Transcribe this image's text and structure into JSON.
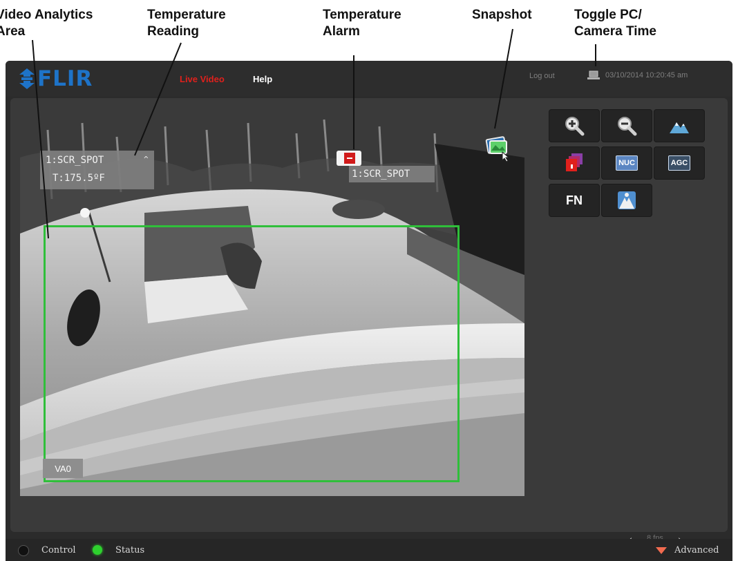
{
  "callouts": {
    "video_analytics": "Video Analytics\nArea",
    "temp_reading": "Temperature\nReading",
    "temp_alarm": "Temperature\nAlarm",
    "snapshot": "Snapshot",
    "toggle_time": "Toggle PC/\nCamera Time"
  },
  "header": {
    "logo_text": "FLIR",
    "nav_live": "Live Video",
    "nav_help": "Help",
    "logout": "Log out",
    "datetime": "03/10/2014 10:20:45 am"
  },
  "video": {
    "spot_reading_name": "1:SCR_SPOT",
    "spot_reading_caret": "^",
    "spot_temperature": "T:175.5ºF",
    "alarm_label": "1:SCR_SPOT",
    "va_label": "VA0"
  },
  "controls": {
    "fn_label": "FN",
    "nuc_label": "NUC",
    "agc_label": "AGC"
  },
  "fps": {
    "text": "8 fps"
  },
  "bottom": {
    "control_label": "Control",
    "status_label": "Status",
    "advanced_label": "Advanced"
  },
  "colors": {
    "nav_active": "#e0201c",
    "brand": "#1e73c8",
    "va_box": "#2fbf3a",
    "status_led": "#2ed12e",
    "advanced_arrow": "#f26b4f"
  }
}
